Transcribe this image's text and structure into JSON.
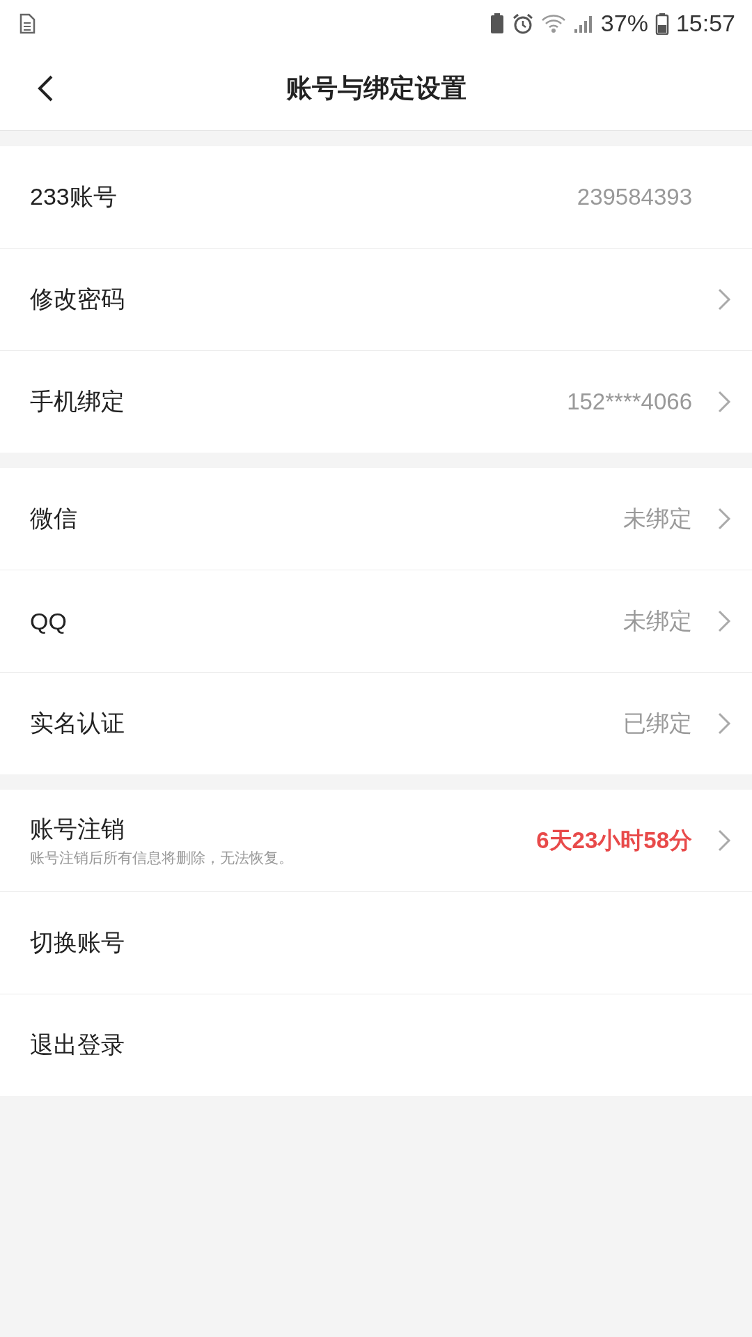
{
  "status_bar": {
    "battery": "37%",
    "time": "15:57"
  },
  "header": {
    "title": "账号与绑定设置"
  },
  "sections": [
    {
      "rows": [
        {
          "label": "233账号",
          "value": "239584393",
          "kind": "plain",
          "alert": false
        },
        {
          "label": "修改密码",
          "kind": "nav"
        },
        {
          "label": "手机绑定",
          "value": "152****4066",
          "kind": "nav",
          "alert": false
        }
      ]
    },
    {
      "rows": [
        {
          "label": "微信",
          "value": "未绑定",
          "kind": "nav",
          "alert": false
        },
        {
          "label": "QQ",
          "value": "未绑定",
          "kind": "nav",
          "alert": false
        },
        {
          "label": "实名认证",
          "value": "已绑定",
          "kind": "nav",
          "alert": false
        }
      ]
    },
    {
      "rows": [
        {
          "label": "账号注销",
          "subtitle": "账号注销后所有信息将删除，无法恢复。",
          "value": "6天23小时58分",
          "kind": "nav",
          "alert": true
        },
        {
          "label": "切换账号",
          "kind": "plain"
        },
        {
          "label": "退出登录",
          "kind": "plain"
        }
      ]
    }
  ]
}
